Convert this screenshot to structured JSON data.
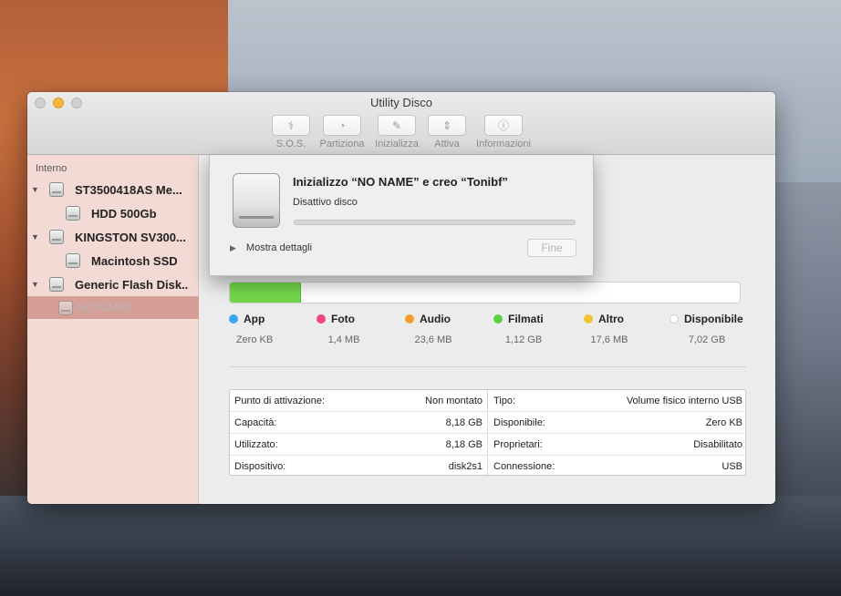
{
  "window": {
    "title": "Utility Disco"
  },
  "toolbar": {
    "items": [
      {
        "label": "S.O.S.",
        "icon": "stethoscope-icon",
        "glyph": "⚕"
      },
      {
        "label": "Partiziona",
        "icon": "partition-icon",
        "glyph": "◔"
      },
      {
        "label": "Inizializza",
        "icon": "erase-icon",
        "glyph": "✎"
      },
      {
        "label": "Attiva",
        "icon": "mount-icon",
        "glyph": "⇕"
      },
      {
        "label": "Informazioni",
        "icon": "info-icon",
        "glyph": "ⓘ"
      }
    ]
  },
  "sidebar": {
    "header": "Interno",
    "items": [
      {
        "label": "ST3500418AS Me..."
      },
      {
        "label": "HDD 500Gb"
      },
      {
        "label": "KINGSTON SV300..."
      },
      {
        "label": "Macintosh SSD"
      },
      {
        "label": "Generic Flash Disk..."
      },
      {
        "label": "NO NAME"
      }
    ]
  },
  "usage": {
    "used_fraction": 0.14,
    "fill_color": "#74d84a",
    "legend": [
      {
        "name": "App",
        "value": "Zero KB",
        "color": "#36a9ee"
      },
      {
        "name": "Foto",
        "value": "1,4 MB",
        "color": "#f0487a"
      },
      {
        "name": "Audio",
        "value": "23,6 MB",
        "color": "#f59c2d"
      },
      {
        "name": "Filmati",
        "value": "1,12 GB",
        "color": "#5bd043"
      },
      {
        "name": "Altro",
        "value": "17,6 MB",
        "color": "#f5c32c"
      },
      {
        "name": "Disponibile",
        "value": "7,02 GB",
        "color": "#ffffff"
      }
    ]
  },
  "info": {
    "left": [
      {
        "label": "Punto di attivazione:",
        "value": "Non montato"
      },
      {
        "label": "Capacità:",
        "value": "8,18 GB"
      },
      {
        "label": "Utilizzato:",
        "value": "8,18 GB"
      },
      {
        "label": "Dispositivo:",
        "value": "disk2s1"
      }
    ],
    "right": [
      {
        "label": "Tipo:",
        "value": "Volume fisico interno USB"
      },
      {
        "label": "Disponibile:",
        "value": "Zero KB"
      },
      {
        "label": "Proprietari:",
        "value": "Disabilitato"
      },
      {
        "label": "Connessione:",
        "value": "USB"
      }
    ]
  },
  "sheet": {
    "title": "Inizializzo “NO NAME” e creo “Tonibf”",
    "status": "Disattivo disco",
    "progress": 0,
    "details_label": "Mostra dettagli",
    "done_label": "Fine"
  }
}
